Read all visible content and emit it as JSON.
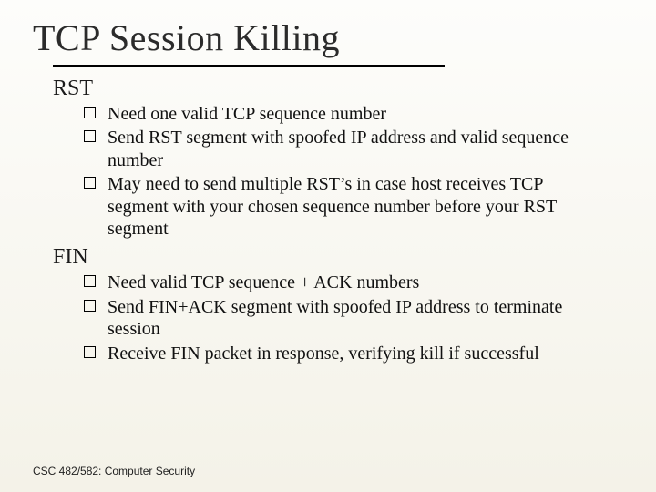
{
  "title": "TCP Session Killing",
  "sections": [
    {
      "heading": "RST",
      "items": [
        "Need one valid TCP sequence number",
        "Send RST segment with spoofed IP address and valid sequence number",
        "May need to send multiple RST’s in case host receives TCP segment with your chosen sequence number before your RST segment"
      ]
    },
    {
      "heading": "FIN",
      "items": [
        "Need valid TCP sequence + ACK numbers",
        "Send FIN+ACK segment with spoofed IP address to terminate session",
        "Receive FIN packet in response, verifying kill if successful"
      ]
    }
  ],
  "footer": "CSC 482/582: Computer Security"
}
